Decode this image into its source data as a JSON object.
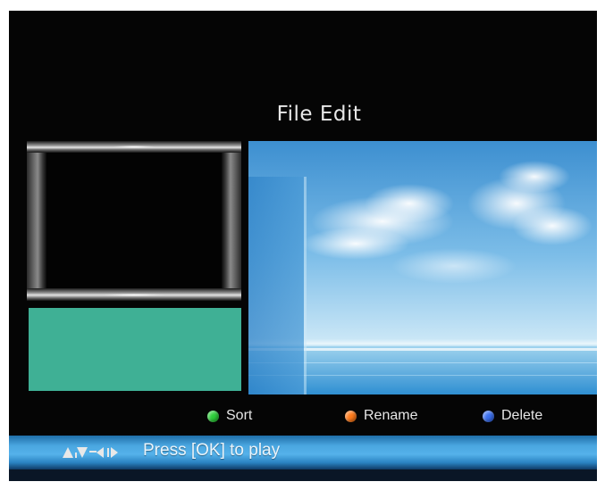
{
  "screen": {
    "title": "File Edit"
  },
  "legend": {
    "items": [
      {
        "key": "green",
        "label": "Sort",
        "color": "#2dcf3a",
        "icon": "green-dot-icon"
      },
      {
        "key": "orange",
        "label": "Rename",
        "color": "#ff7a1a",
        "icon": "orange-dot-icon"
      },
      {
        "key": "blue",
        "label": "Delete",
        "color": "#3a6ff0",
        "icon": "blue-dot-icon"
      }
    ]
  },
  "hint": {
    "text": "Press [OK] to play",
    "icon": "arrow-keys-icon"
  },
  "colors": {
    "background": "#050505",
    "info_panel": "#3fb095",
    "hint_bar": "#4aa6e0",
    "title_text": "#e8e8e8"
  }
}
